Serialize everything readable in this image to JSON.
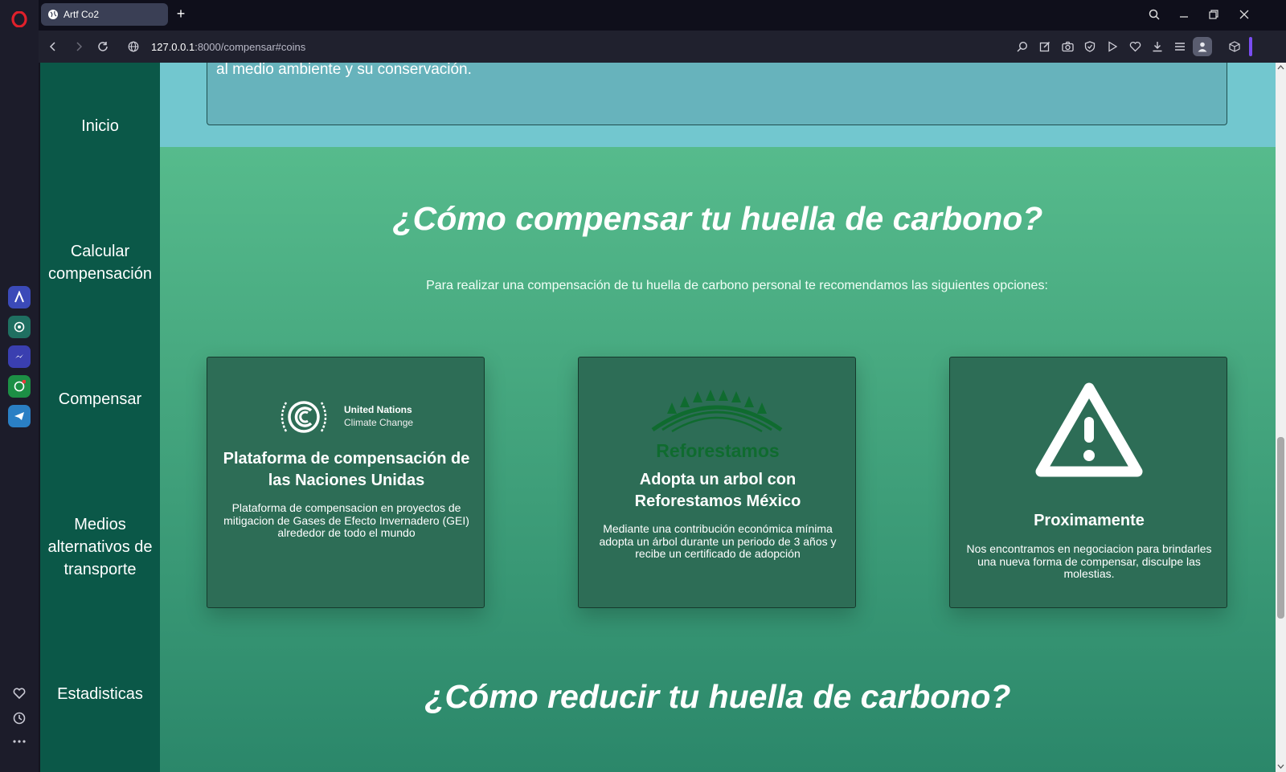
{
  "browser": {
    "tab_title": "Artf Co2",
    "url_host": "127.0.0.1",
    "url_path": ":8000/compensar#coins"
  },
  "sidebar": {
    "items": [
      {
        "label": "Inicio"
      },
      {
        "label": "Calcular compensación"
      },
      {
        "label": "Compensar"
      },
      {
        "label": "Medios alternativos de transporte"
      },
      {
        "label": "Estadisticas"
      }
    ]
  },
  "top_section": {
    "text": "al medio ambiente y su conservación."
  },
  "compensate_section": {
    "heading": "¿Cómo compensar tu huella de carbono?",
    "intro": "Para realizar una compensación de tu huella de carbono personal te recomendamos las siguientes opciones:"
  },
  "cards": [
    {
      "logo_line1": "United Nations",
      "logo_line2": "Climate Change",
      "title": "Plataforma de compensación de las Naciones Unidas",
      "body": "Plataforma de compensacion en proyectos de mitigacion de Gases de Efecto Invernadero (GEI) alrededor de todo el mundo"
    },
    {
      "logo_text": "Reforestamos",
      "title": "Adopta un arbol con Reforestamos México",
      "body": "Mediante una contribución económica mínima adopta un árbol durante un periodo de 3 años y recibe un certificado de adopción"
    },
    {
      "icon": "warning-icon",
      "title": "Proximamente",
      "body": "Nos encontramos en negociacion para brindarles una nueva forma de compensar, disculpe las molestias."
    }
  ],
  "reduce_section": {
    "heading": "¿Cómo reducir tu huella de carbono?"
  },
  "colors": {
    "sidebar": "#0b5848",
    "top_band": "#72c7cf",
    "green_top": "#56bb8c",
    "green_bottom": "#2b876a",
    "card": "#2d6d56",
    "reforestamos_green": "#0f6b2f"
  }
}
